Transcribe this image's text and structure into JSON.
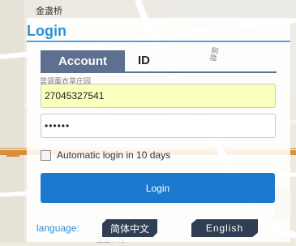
{
  "map": {
    "labels": [
      "金盏桥",
      "蓝调薰衣草庄园",
      "薛营",
      "金盏二村"
    ]
  },
  "login": {
    "title": "Login",
    "tabs": [
      {
        "label": "Account",
        "active": true
      },
      {
        "label": "ID",
        "active": false
      }
    ],
    "username_value": "27045327541",
    "password_value": "••••••",
    "remember_label": "Automatic login in 10 days",
    "remember_checked": false,
    "submit_label": "Login"
  },
  "language": {
    "label": "language:",
    "options": [
      "简体中文",
      "English"
    ]
  },
  "colors": {
    "accent": "#2d8fd5",
    "button": "#1b79cf",
    "tab_active": "#5e6f8f",
    "lang_button": "#2f3e52",
    "autofill": "#faffbd"
  }
}
